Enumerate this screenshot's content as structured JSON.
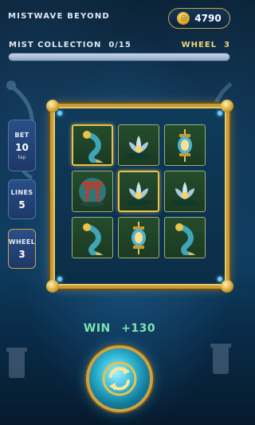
{
  "header": {
    "title": "MISTWAVE BEYOND",
    "coins": "4790",
    "coin_icon": "gold-coin-icon"
  },
  "collection": {
    "label": "MIST COLLECTION",
    "count": "0/15",
    "progress": 0
  },
  "wheel": {
    "label": "WHEEL",
    "value": "3"
  },
  "side": {
    "bet": {
      "label": "BET",
      "value": "10",
      "sub": "tap"
    },
    "lines": {
      "label": "LINES",
      "value": "5"
    },
    "wheel": {
      "label": "WHEEL",
      "value": "3"
    }
  },
  "reels": {
    "rows": [
      [
        {
          "symbol": "koi-fish",
          "highlight": true
        },
        {
          "symbol": "lotus",
          "highlight": false
        },
        {
          "symbol": "lantern",
          "highlight": false
        }
      ],
      [
        {
          "symbol": "torii-gate",
          "highlight": false
        },
        {
          "symbol": "lotus",
          "highlight": true
        },
        {
          "symbol": "lotus",
          "highlight": false
        }
      ],
      [
        {
          "symbol": "koi-fish",
          "highlight": false
        },
        {
          "symbol": "lantern",
          "highlight": false
        },
        {
          "symbol": "koi-fish",
          "highlight": false
        }
      ]
    ]
  },
  "win": {
    "label": "WIN",
    "amount": "+130"
  },
  "spin_button": {
    "icon": "spin-arrows-icon"
  },
  "colors": {
    "gold": "#c9a447",
    "win_text": "#7fe3b0",
    "panel": "#1d3866",
    "cell_bg": "#1b3a22"
  }
}
